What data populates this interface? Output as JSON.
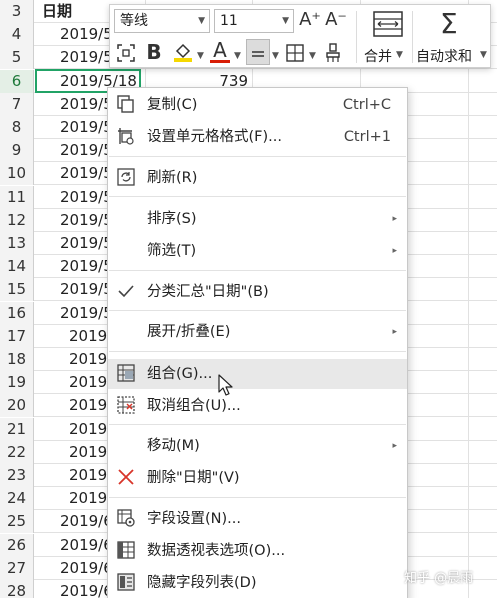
{
  "sheet": {
    "rows": [
      {
        "num": "3",
        "a": "日期",
        "b": "",
        "header": true
      },
      {
        "num": "4",
        "a": "2019/5",
        "b": ""
      },
      {
        "num": "5",
        "a": "2019/5",
        "b": ""
      },
      {
        "num": "6",
        "a": "2019/5/18",
        "b": "739",
        "selected": true
      },
      {
        "num": "7",
        "a": "2019/5",
        "b": ""
      },
      {
        "num": "8",
        "a": "2019/5",
        "b": ""
      },
      {
        "num": "9",
        "a": "2019/5",
        "b": ""
      },
      {
        "num": "10",
        "a": "2019/5",
        "b": ""
      },
      {
        "num": "11",
        "a": "2019/5",
        "b": ""
      },
      {
        "num": "12",
        "a": "2019/5",
        "b": ""
      },
      {
        "num": "13",
        "a": "2019/5",
        "b": ""
      },
      {
        "num": "14",
        "a": "2019/5",
        "b": ""
      },
      {
        "num": "15",
        "a": "2019/5",
        "b": ""
      },
      {
        "num": "16",
        "a": "2019/5",
        "b": ""
      },
      {
        "num": "17",
        "a": "2019/",
        "b": "",
        "indent": true
      },
      {
        "num": "18",
        "a": "2019/",
        "b": "",
        "indent": true
      },
      {
        "num": "19",
        "a": "2019/",
        "b": "",
        "indent": true
      },
      {
        "num": "20",
        "a": "2019/",
        "b": "",
        "indent": true
      },
      {
        "num": "21",
        "a": "2019/",
        "b": "",
        "indent": true
      },
      {
        "num": "22",
        "a": "2019/",
        "b": "",
        "indent": true
      },
      {
        "num": "23",
        "a": "2019/",
        "b": "",
        "indent": true
      },
      {
        "num": "24",
        "a": "2019/",
        "b": "",
        "indent": true
      },
      {
        "num": "25",
        "a": "2019/6",
        "b": ""
      },
      {
        "num": "26",
        "a": "2019/6",
        "b": ""
      },
      {
        "num": "27",
        "a": "2019/6",
        "b": ""
      },
      {
        "num": "28",
        "a": "2019/6",
        "b": ""
      }
    ]
  },
  "mini_toolbar": {
    "font_name": "等线",
    "font_size": "11",
    "grow_font": "A⁺",
    "shrink_font": "A⁻",
    "bold": "B",
    "font_color_letter": "A",
    "merge_label": "合并",
    "autosum_label": "自动求和",
    "fill_color": "#f5d800",
    "font_color": "#d81e06"
  },
  "context_menu": {
    "items": [
      {
        "label": "复制(C)",
        "shortcut": "Ctrl+C",
        "icon": "copy-icon"
      },
      {
        "label": "设置单元格格式(F)...",
        "shortcut": "Ctrl+1",
        "icon": "format-cells-icon"
      },
      {
        "label": "刷新(R)",
        "shortcut": "",
        "icon": "refresh-icon"
      },
      {
        "label": "排序(S)",
        "shortcut": "",
        "icon": "",
        "submenu": true
      },
      {
        "label": "筛选(T)",
        "shortcut": "",
        "icon": "",
        "submenu": true
      },
      {
        "label": "分类汇总\"日期\"(B)",
        "shortcut": "",
        "icon": "checkmark-icon"
      },
      {
        "label": "展开/折叠(E)",
        "shortcut": "",
        "icon": "",
        "submenu": true
      },
      {
        "label": "组合(G)...",
        "shortcut": "",
        "icon": "group-icon",
        "hover": true
      },
      {
        "label": "取消组合(U)...",
        "shortcut": "",
        "icon": "ungroup-icon"
      },
      {
        "label": "移动(M)",
        "shortcut": "",
        "icon": "",
        "submenu": true
      },
      {
        "label": "删除\"日期\"(V)",
        "shortcut": "",
        "icon": "delete-x-icon"
      },
      {
        "label": "字段设置(N)...",
        "shortcut": "",
        "icon": "field-settings-icon"
      },
      {
        "label": "数据透视表选项(O)...",
        "shortcut": "",
        "icon": "pivot-options-icon"
      },
      {
        "label": "隐藏字段列表(D)",
        "shortcut": "",
        "icon": "field-list-icon"
      }
    ],
    "arrow_glyph": "▸",
    "delete_color": "#d8352a"
  },
  "watermark": "知乎 @晨雨"
}
